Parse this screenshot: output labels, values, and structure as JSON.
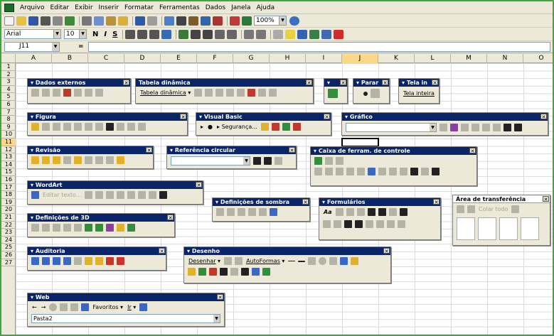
{
  "menu": [
    "Arquivo",
    "Editar",
    "Exibir",
    "Inserir",
    "Formatar",
    "Ferramentas",
    "Dados",
    "Janela",
    "Ajuda"
  ],
  "standard_toolbar": {
    "zoom": "100%"
  },
  "formatting_toolbar": {
    "font": "Arial",
    "size": "10",
    "bold": "N",
    "italic": "I",
    "underline": "S"
  },
  "formula_bar": {
    "cell_ref": "J11",
    "eq": "="
  },
  "columns": [
    "A",
    "B",
    "C",
    "D",
    "E",
    "F",
    "G",
    "H",
    "I",
    "J",
    "K",
    "L",
    "M",
    "N",
    "O"
  ],
  "rows": [
    "1",
    "2",
    "3",
    "4",
    "5",
    "6",
    "7",
    "8",
    "9",
    "10",
    "11",
    "12",
    "13",
    "14",
    "15",
    "16",
    "17",
    "18",
    "19",
    "20",
    "21",
    "22",
    "23",
    "24",
    "25",
    "26",
    "27"
  ],
  "active": {
    "column": "J",
    "row": "11"
  },
  "palettes": {
    "dados_externos": {
      "title": "Dados externos"
    },
    "tabela_dinamica": {
      "title": "Tabela dinâmica",
      "menu": "Tabela dinâmica"
    },
    "parar": {
      "title": "Parar"
    },
    "tela_inteira": {
      "title": "Tela in",
      "button": "Tela inteira"
    },
    "figura": {
      "title": "Figura"
    },
    "visual_basic": {
      "title": "Visual Basic",
      "security": "Segurança..."
    },
    "grafico": {
      "title": "Gráfico"
    },
    "revisao": {
      "title": "Revisão"
    },
    "referencia_circular": {
      "title": "Referência circular"
    },
    "caixa_controle": {
      "title": "Caixa de ferram. de controle"
    },
    "wordart": {
      "title": "WordArt",
      "edit_text": "Editar texto..."
    },
    "sombra": {
      "title": "Definições de sombra"
    },
    "formularios": {
      "title": "Formulários"
    },
    "transferencia": {
      "title": "Área de transferência",
      "paste_all": "Colar todo"
    },
    "definicoes_3d": {
      "title": "Definições de 3D"
    },
    "auditoria": {
      "title": "Auditoria"
    },
    "desenho": {
      "title": "Desenho",
      "draw_menu": "Desenhar",
      "autoshapes": "AutoFormas"
    },
    "web": {
      "title": "Web",
      "favorites": "Favoritos",
      "go": "Ir",
      "address": "Pasta2"
    }
  }
}
